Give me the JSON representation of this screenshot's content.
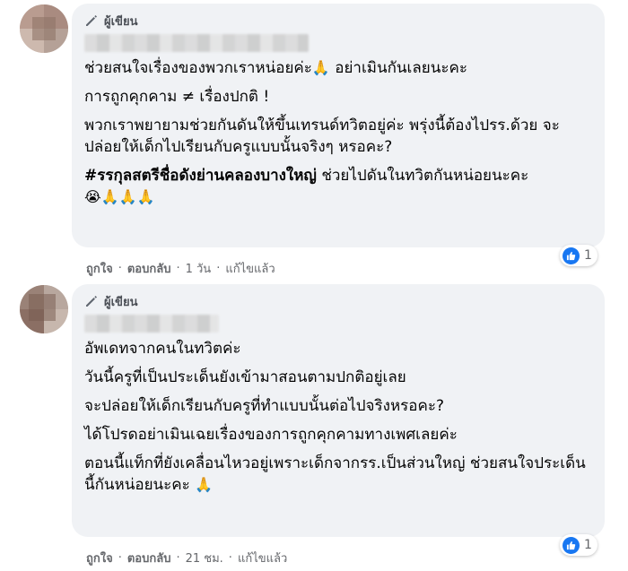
{
  "comments": [
    {
      "author_badge": "ผู้เขียน",
      "paragraphs": [
        {
          "text": "ช่วยสนใจเรื่องของพวกเราหน่อยค่ะ",
          "emoji": "🙏",
          "after": " อย่าเมินกันเลยนะคะ"
        },
        {
          "text": "การถูกคุกคาม ≠ เรื่องปกติ !"
        },
        {
          "text": "พวกเราพยายามช่วยกันดันให้ขึ้นเทรนด์ทวิตอยู่ค่ะ พรุ่งนี้ต้องไปรร.ด้วย จะปล่อยให้เด็กไปเรียนกับครูแบบนั้นจริงๆ หรอคะ?"
        },
        {
          "hashtag": "#รรกุลสตรีชื่อดังย่านคลองบางใหญ่",
          "text": " ช่วยไปดันในทวิตกันหน่อยนะคะ ",
          "emoji": "😭🙏🙏🙏"
        }
      ],
      "actions": {
        "like": "ถูกใจ",
        "reply": "ตอบกลับ",
        "time": "1 วัน",
        "edited": "แก้ไขแล้ว"
      },
      "reaction_count": "1"
    },
    {
      "author_badge": "ผู้เขียน",
      "paragraphs": [
        {
          "text": "อัพเดทจากคนในทวิตค่ะ"
        },
        {
          "text": "วันนี้ครูที่เป็นประเด็นยังเข้ามาสอนตามปกติอยู่เลย"
        },
        {
          "text": "จะปล่อยให้เด็กเรียนกับครูที่ทำแบบนั้นต่อไปจริงหรอคะ?"
        },
        {
          "text": "ได้โปรดอย่าเมินเฉยเรื่องของการถูกคุกคามทางเพศเลยค่ะ"
        },
        {
          "text": "ตอนนี้แท็กที่ยังเคลื่อนไหวอยู่เพราะเด็กจากรร.เป็นส่วนใหญ่ ช่วยสนใจประเด็นนี้กันหน่อยนะคะ ",
          "emoji": "🙏"
        }
      ],
      "actions": {
        "like": "ถูกใจ",
        "reply": "ตอบกลับ",
        "time": "21 ชม.",
        "edited": "แก้ไขแล้ว"
      },
      "reaction_count": "1"
    }
  ],
  "icons": {
    "pencil": "pencil-icon",
    "like": "thumbs-up-icon"
  },
  "colors": {
    "bubble": "#f0f2f5",
    "like_blue": "#1877f2",
    "meta_gray": "#65676b"
  }
}
